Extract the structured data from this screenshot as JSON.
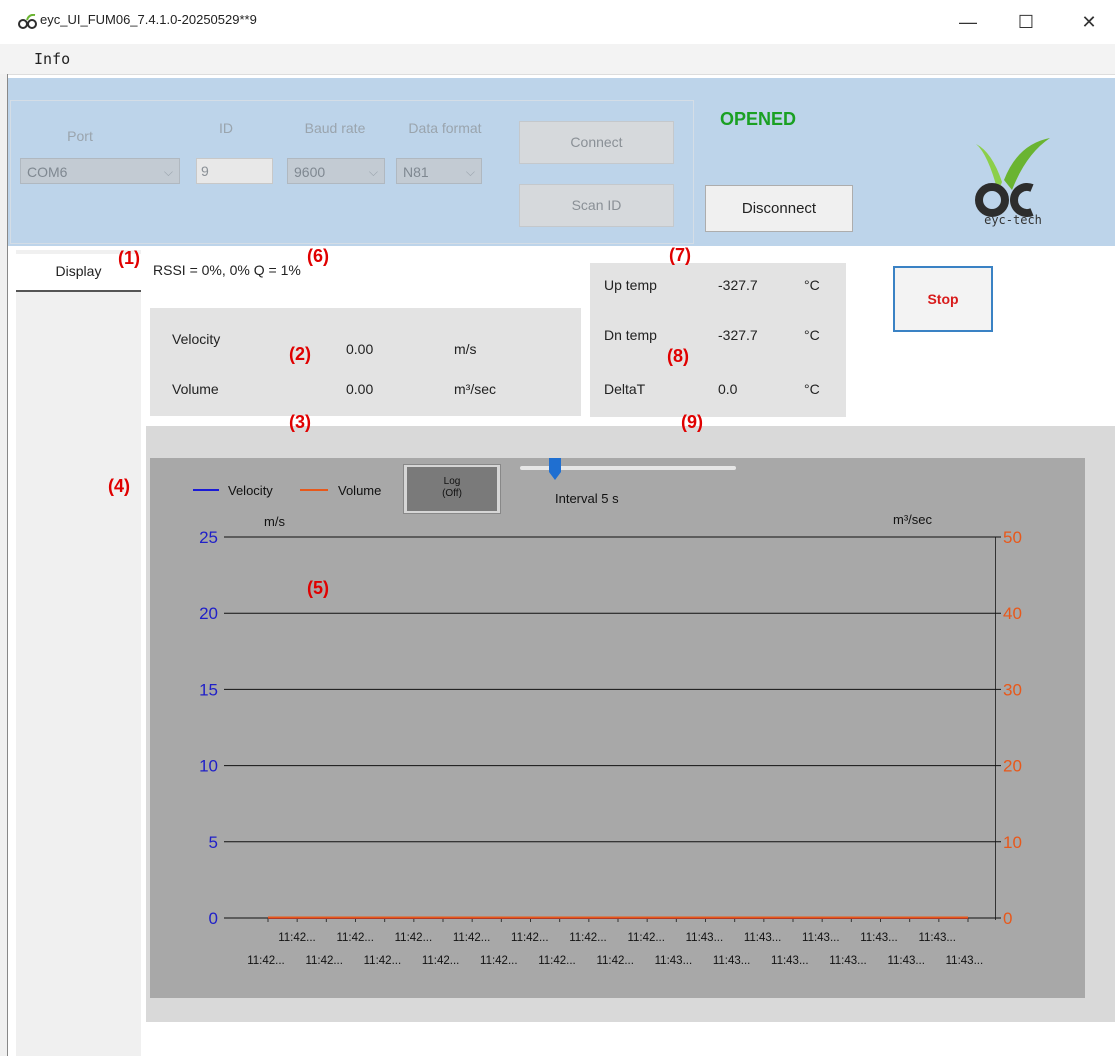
{
  "window": {
    "title": "eyc_UI_FUM06_7.4.1.0-20250529**9",
    "minimize": "—",
    "maximize": "☐",
    "close": "✕"
  },
  "menu": {
    "info": "Info"
  },
  "connection": {
    "port_label": "Port",
    "port_value": "COM6",
    "id_label": "ID",
    "id_value": "9",
    "baud_label": "Baud rate",
    "baud_value": "9600",
    "format_label": "Data format",
    "format_value": "N81",
    "connect_label": "Connect",
    "scan_label": "Scan ID",
    "status": "OPENED",
    "disconnect_label": "Disconnect"
  },
  "logo": {
    "text": "eyc-tech",
    "colors": {
      "green": "#6ab431",
      "dark": "#2d2d2d"
    }
  },
  "tabs": {
    "display": "Display"
  },
  "rssi": "RSSI = 0%, 0% Q = 1%",
  "measurements": {
    "velocity_label": "Velocity",
    "velocity_value": "0.00",
    "velocity_unit": "m/s",
    "volume_label": "Volume",
    "volume_value": "0.00",
    "volume_unit": "m³/sec"
  },
  "temperatures": {
    "up_label": "Up temp",
    "up_value": "-327.7",
    "up_unit": "°C",
    "dn_label": "Dn temp",
    "dn_value": "-327.7",
    "dn_unit": "°C",
    "delta_label": "DeltaT",
    "delta_value": "0.0",
    "delta_unit": "°C"
  },
  "stop_label": "Stop",
  "chart_controls": {
    "log_label_1": "Log",
    "log_label_2": "(Off)",
    "interval": "Interval 5 s",
    "slider_level": 0.18
  },
  "annotations": [
    "(1)",
    "(2)",
    "(3)",
    "(4)",
    "(5)",
    "(6)",
    "(7)",
    "(8)",
    "(9)"
  ],
  "chart_data": {
    "type": "line",
    "xlabel": "",
    "left_unit": "m/s",
    "right_unit": "m³/sec",
    "left_ylim": [
      0,
      25
    ],
    "right_ylim": [
      0,
      50
    ],
    "left_ticks": [
      "0",
      "5",
      "10",
      "15",
      "20",
      "25"
    ],
    "right_ticks": [
      "0",
      "10",
      "20",
      "30",
      "40",
      "50"
    ],
    "x_ticks_row1": [
      "11:42...",
      "11:42...",
      "11:42...",
      "11:42...",
      "11:42...",
      "11:42...",
      "11:42...",
      "11:43...",
      "11:43...",
      "11:43...",
      "11:43...",
      "11:43..."
    ],
    "x_ticks_row2": [
      "11:42...",
      "11:42...",
      "11:42...",
      "11:42...",
      "11:42...",
      "11:42...",
      "11:42...",
      "11:43...",
      "11:43...",
      "11:43...",
      "11:43...",
      "11:43...",
      "11:43..."
    ],
    "grid": true,
    "legend": "top-left",
    "series": [
      {
        "name": "Velocity",
        "color": "#1a1ad6",
        "values": [
          0,
          0,
          0,
          0,
          0,
          0,
          0,
          0,
          0,
          0,
          0,
          0,
          0,
          0,
          0,
          0,
          0,
          0,
          0,
          0,
          0,
          0,
          0,
          0,
          0
        ]
      },
      {
        "name": "Volume",
        "color": "#e8581a",
        "values": [
          0,
          0,
          0,
          0,
          0,
          0,
          0,
          0,
          0,
          0,
          0,
          0,
          0,
          0,
          0,
          0,
          0,
          0,
          0,
          0,
          0,
          0,
          0,
          0,
          0
        ]
      }
    ],
    "left_axis_color": "#2020c8",
    "right_axis_color": "#e8581a"
  }
}
